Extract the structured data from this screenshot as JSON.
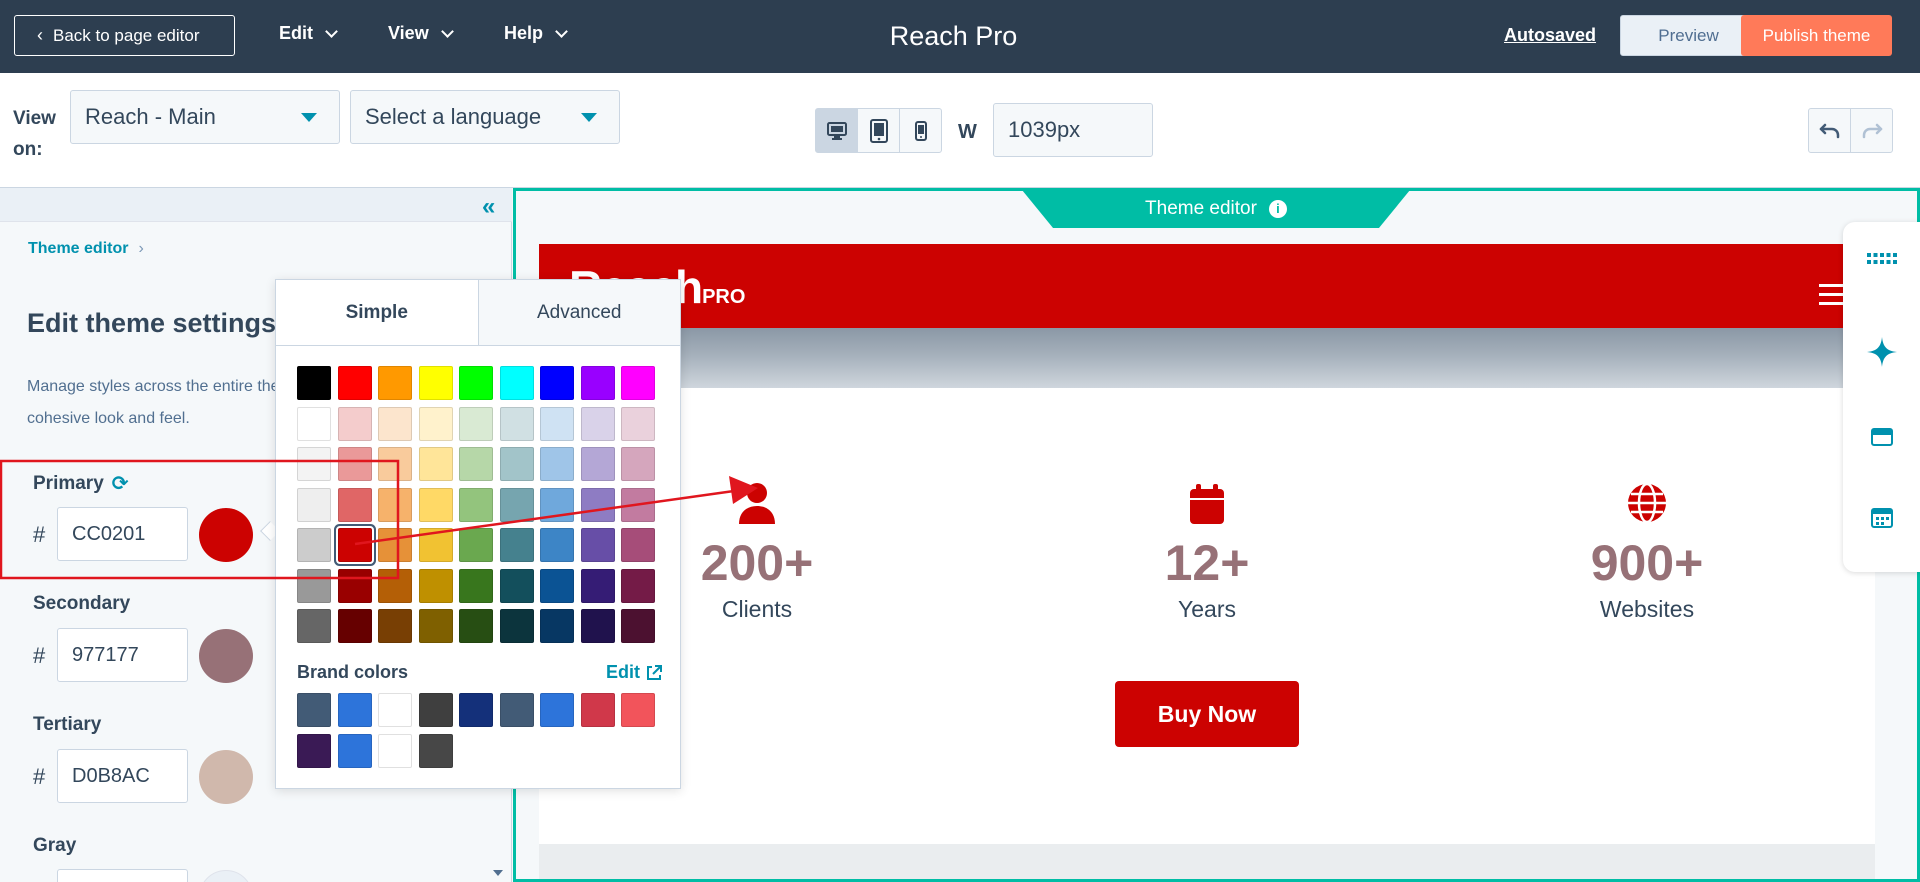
{
  "topbar": {
    "back_label": "Back to page editor",
    "menus": [
      "Edit",
      "View",
      "Help"
    ],
    "title": "Reach Pro",
    "autosaved": "Autosaved",
    "preview_label": "Preview",
    "publish_label": "Publish theme"
  },
  "toolbar": {
    "view_on_label": "View on:",
    "view_on_value": "Reach - Main",
    "language_placeholder": "Select a language",
    "devices": [
      "desktop-icon",
      "tablet-icon",
      "mobile-icon"
    ],
    "active_device": "desktop",
    "width_label": "W",
    "width_value": "1039px"
  },
  "panel": {
    "breadcrumb": "Theme editor",
    "heading": "Edit theme settings",
    "description": "Manage styles across the entire theme to create a cohesive look and feel.",
    "colors": [
      {
        "label": "Primary",
        "hex": "CC0201",
        "swatch": "#cc0201"
      },
      {
        "label": "Secondary",
        "hex": "977177",
        "swatch": "#977177"
      },
      {
        "label": "Tertiary",
        "hex": "D0B8AC",
        "swatch": "#d0b8ac"
      },
      {
        "label": "Gray",
        "hex": "",
        "swatch": "#eaf0f6"
      }
    ]
  },
  "picker": {
    "tabs": [
      "Simple",
      "Advanced"
    ],
    "active_tab": "Simple",
    "palette": [
      [
        "#000000",
        "#ff0000",
        "#ff9900",
        "#ffff00",
        "#00ff00",
        "#00ffff",
        "#0000ff",
        "#9900ff",
        "#ff00ff"
      ],
      [
        "#ffffff",
        "#f4cccc",
        "#fce5cd",
        "#fff2cc",
        "#d9ead3",
        "#d0e0e3",
        "#cfe2f3",
        "#d9d2e9",
        "#ead1dc"
      ],
      [
        "#f3f3f3",
        "#ea9999",
        "#f9cb9c",
        "#ffe599",
        "#b6d7a8",
        "#a2c4c9",
        "#9fc5e8",
        "#b4a7d6",
        "#d5a6bd"
      ],
      [
        "#eeeeee",
        "#e06666",
        "#f6b26b",
        "#ffd966",
        "#93c47d",
        "#76a5af",
        "#6fa8dc",
        "#8e7cc3",
        "#c27ba0"
      ],
      [
        "#cccccc",
        "#cc0201",
        "#e69138",
        "#f1c232",
        "#6aa84f",
        "#45818e",
        "#3d85c6",
        "#674ea7",
        "#a64d79"
      ],
      [
        "#999999",
        "#990000",
        "#b45f06",
        "#bf9000",
        "#38761d",
        "#134f5c",
        "#0b5394",
        "#351c75",
        "#741b47"
      ],
      [
        "#666666",
        "#660000",
        "#783f04",
        "#7f6000",
        "#274e13",
        "#0c343d",
        "#073763",
        "#20124d",
        "#4c1130"
      ]
    ],
    "selected": "#cc0201",
    "brand_label": "Brand colors",
    "brand_edit": "Edit",
    "brand_colors": [
      "#425b76",
      "#2d74da",
      "#ffffff",
      "#3f3f3f",
      "#14307a",
      "#425b76",
      "#2d74da",
      "#d0384a",
      "#f2545b",
      "#3a1a55",
      "#2d74da",
      "#ffffff",
      "#474747"
    ]
  },
  "preview": {
    "tab_label": "Theme editor",
    "site": {
      "logo_main": "Reach",
      "logo_small": "PRO",
      "stats": [
        {
          "icon": "user-icon",
          "value": "200+",
          "label": "Clients"
        },
        {
          "icon": "calendar-icon",
          "value": "12+",
          "label": "Years"
        },
        {
          "icon": "globe-icon",
          "value": "900+",
          "label": "Websites"
        }
      ],
      "cta": "Buy Now"
    }
  },
  "colors": {
    "topbar_bg": "#2d3e50",
    "accent": "#0091ae",
    "teal": "#00bda5",
    "publish": "#ff7a59",
    "brand_primary": "#cc0201",
    "annotation": "#e0161e"
  }
}
